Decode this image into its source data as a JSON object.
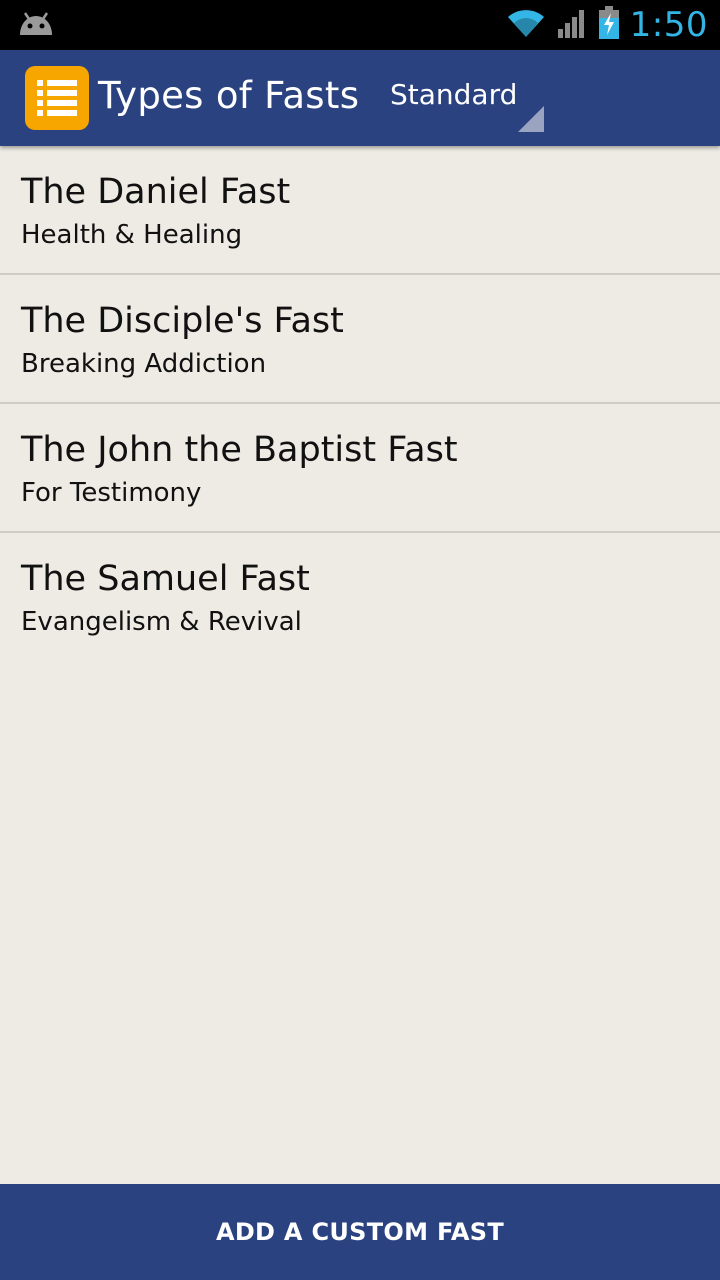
{
  "status_bar": {
    "time": "1:50",
    "notification_icon": "android-icon",
    "icons": [
      "wifi-icon",
      "signal-icon",
      "battery-charging-icon"
    ],
    "accent_color": "#33b5e5"
  },
  "action_bar": {
    "title": "Types of Fasts",
    "app_icon": "list-icon",
    "spinner_selected": "Standard",
    "background_color": "#2b4280",
    "icon_color": "#f7a600"
  },
  "fasts": [
    {
      "title": "The Daniel Fast",
      "subtitle": "Health & Healing"
    },
    {
      "title": "The Disciple's Fast",
      "subtitle": "Breaking Addiction"
    },
    {
      "title": "The John the Baptist Fast",
      "subtitle": "For Testimony"
    },
    {
      "title": "The Samuel Fast",
      "subtitle": "Evangelism & Revival"
    }
  ],
  "footer": {
    "button_label": "ADD A CUSTOM FAST"
  },
  "colors": {
    "background": "#eeebe4",
    "divider": "#cfccc6"
  }
}
